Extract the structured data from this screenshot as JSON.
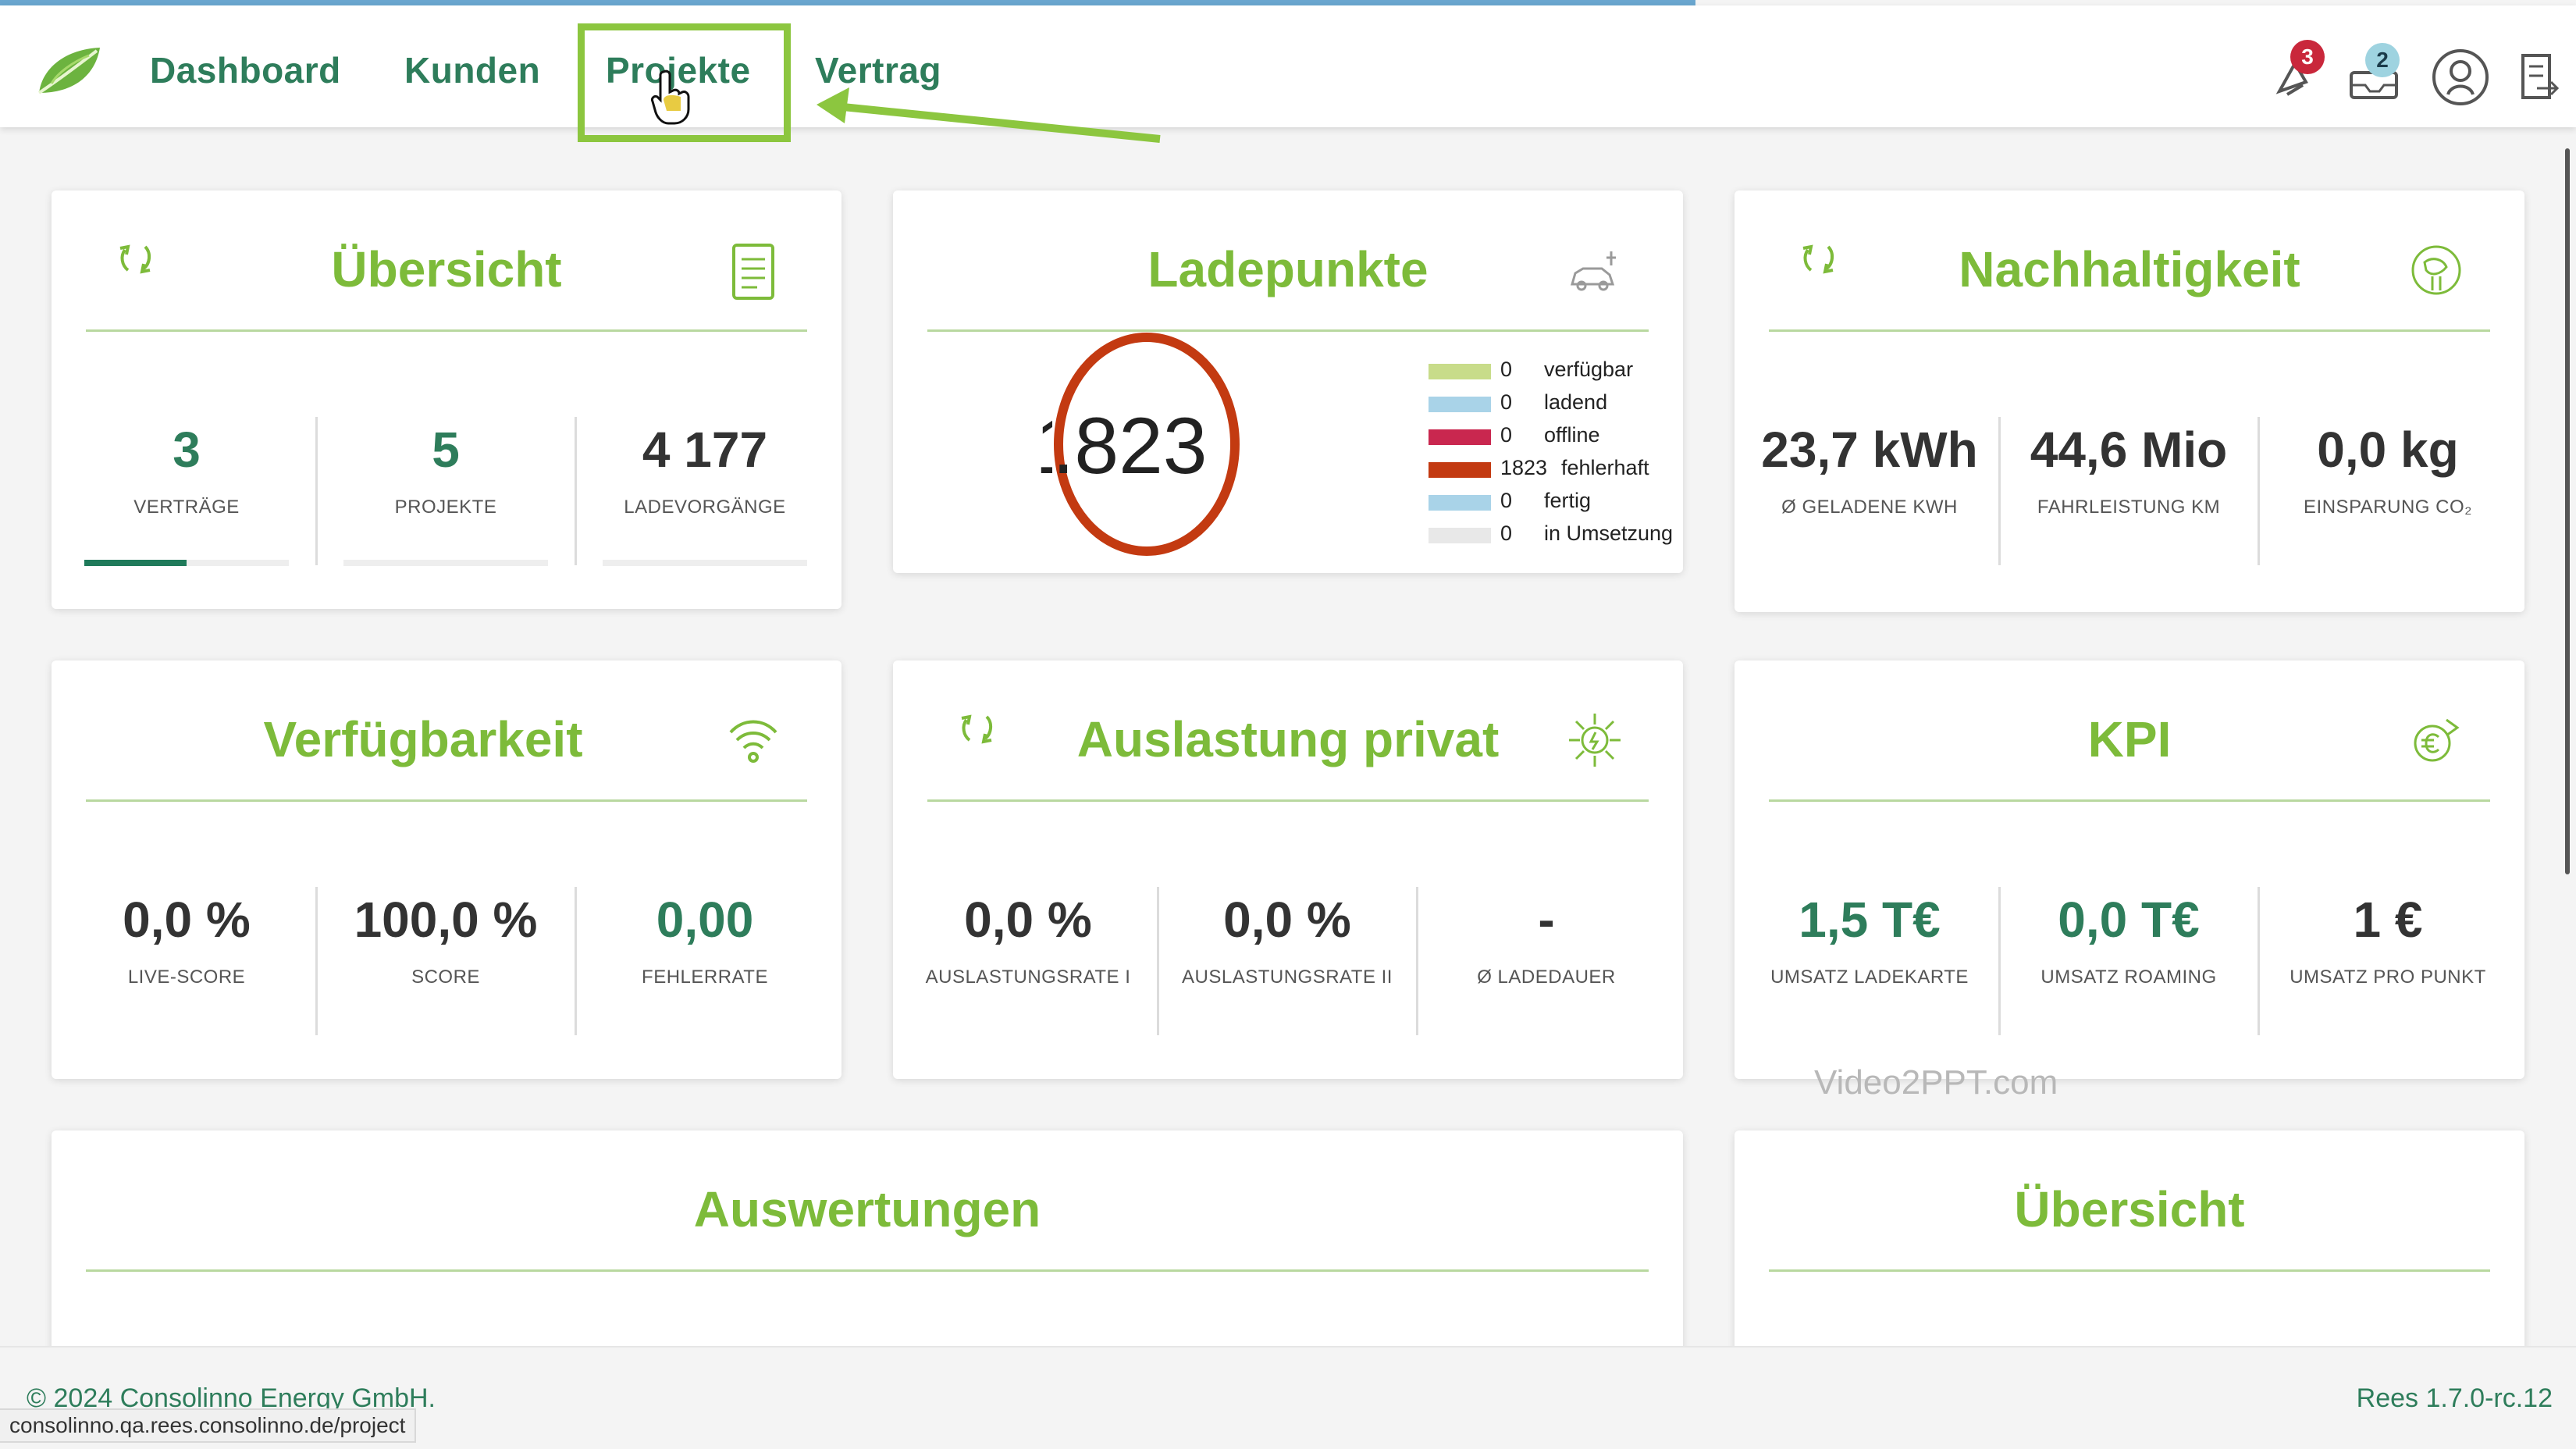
{
  "nav": {
    "items": [
      {
        "label": "Dashboard"
      },
      {
        "label": "Kunden"
      },
      {
        "label": "Projekte"
      },
      {
        "label": "Vertrag"
      }
    ],
    "notifications_count": "3",
    "messages_count": "2"
  },
  "cards": {
    "uebersicht": {
      "title": "Übersicht",
      "stats": [
        {
          "value": "3",
          "label": "VERTRÄGE"
        },
        {
          "value": "5",
          "label": "PROJEKTE"
        },
        {
          "value": "4 177",
          "label": "LADEVORGÄNGE"
        }
      ],
      "progress_fraction": 0.5
    },
    "ladepunkte": {
      "title": "Ladepunkte",
      "center_value": ".823",
      "center_prefix": "1",
      "legend": [
        {
          "count": "0",
          "label": "verfügbar",
          "color": "#c8dc8a"
        },
        {
          "count": "0",
          "label": "ladend",
          "color": "#a9d3e8"
        },
        {
          "count": "0",
          "label": "offline",
          "color": "#c9274f"
        },
        {
          "count": "1823",
          "label": "fehlerhaft",
          "color": "#c33a11"
        },
        {
          "count": "0",
          "label": "fertig",
          "color": "#a9d3e8"
        },
        {
          "count": "0",
          "label": "in Umsetzung",
          "color": "#e8e8e8"
        }
      ]
    },
    "nachhaltigkeit": {
      "title": "Nachhaltigkeit",
      "stats": [
        {
          "value": "23,7 kWh",
          "label": "Ø GELADENE KWH"
        },
        {
          "value": "44,6 Mio",
          "label": "FAHRLEISTUNG KM"
        },
        {
          "value": "0,0 kg",
          "label": "EINSPARUNG CO₂"
        }
      ]
    },
    "verfuegbarkeit": {
      "title": "Verfügbarkeit",
      "stats": [
        {
          "value": "0,0 %",
          "label": "LIVE-SCORE"
        },
        {
          "value": "100,0 %",
          "label": "SCORE"
        },
        {
          "value": "0,00",
          "label": "FEHLERRATE"
        }
      ]
    },
    "auslastung": {
      "title": "Auslastung privat",
      "stats": [
        {
          "value": "0,0 %",
          "label": "AUSLASTUNGSRATE I"
        },
        {
          "value": "0,0 %",
          "label": "AUSLASTUNGSRATE II"
        },
        {
          "value": "-",
          "label": "Ø LADEDAUER"
        }
      ]
    },
    "kpi": {
      "title": "KPI",
      "stats": [
        {
          "value": "1,5 T€",
          "label": "UMSATZ LADEKARTE"
        },
        {
          "value": "0,0 T€",
          "label": "UMSATZ ROAMING"
        },
        {
          "value": "1 €",
          "label": "UMSATZ PRO PUNKT"
        }
      ]
    },
    "auswertungen": {
      "title": "Auswertungen"
    },
    "uebersicht2": {
      "title": "Übersicht"
    }
  },
  "watermark": "Video2PPT.com",
  "footer": {
    "copyright": "© 2024 Consolinno Energy GmbH.",
    "version": "Rees 1.7.0-rc.12",
    "status_url": "consolinno.qa.rees.consolinno.de/project"
  },
  "colors": {
    "brand_green": "#7dbb3a",
    "dark_green": "#2e7d5b",
    "highlight": "#8cc63f",
    "ring": "#c33a11"
  }
}
